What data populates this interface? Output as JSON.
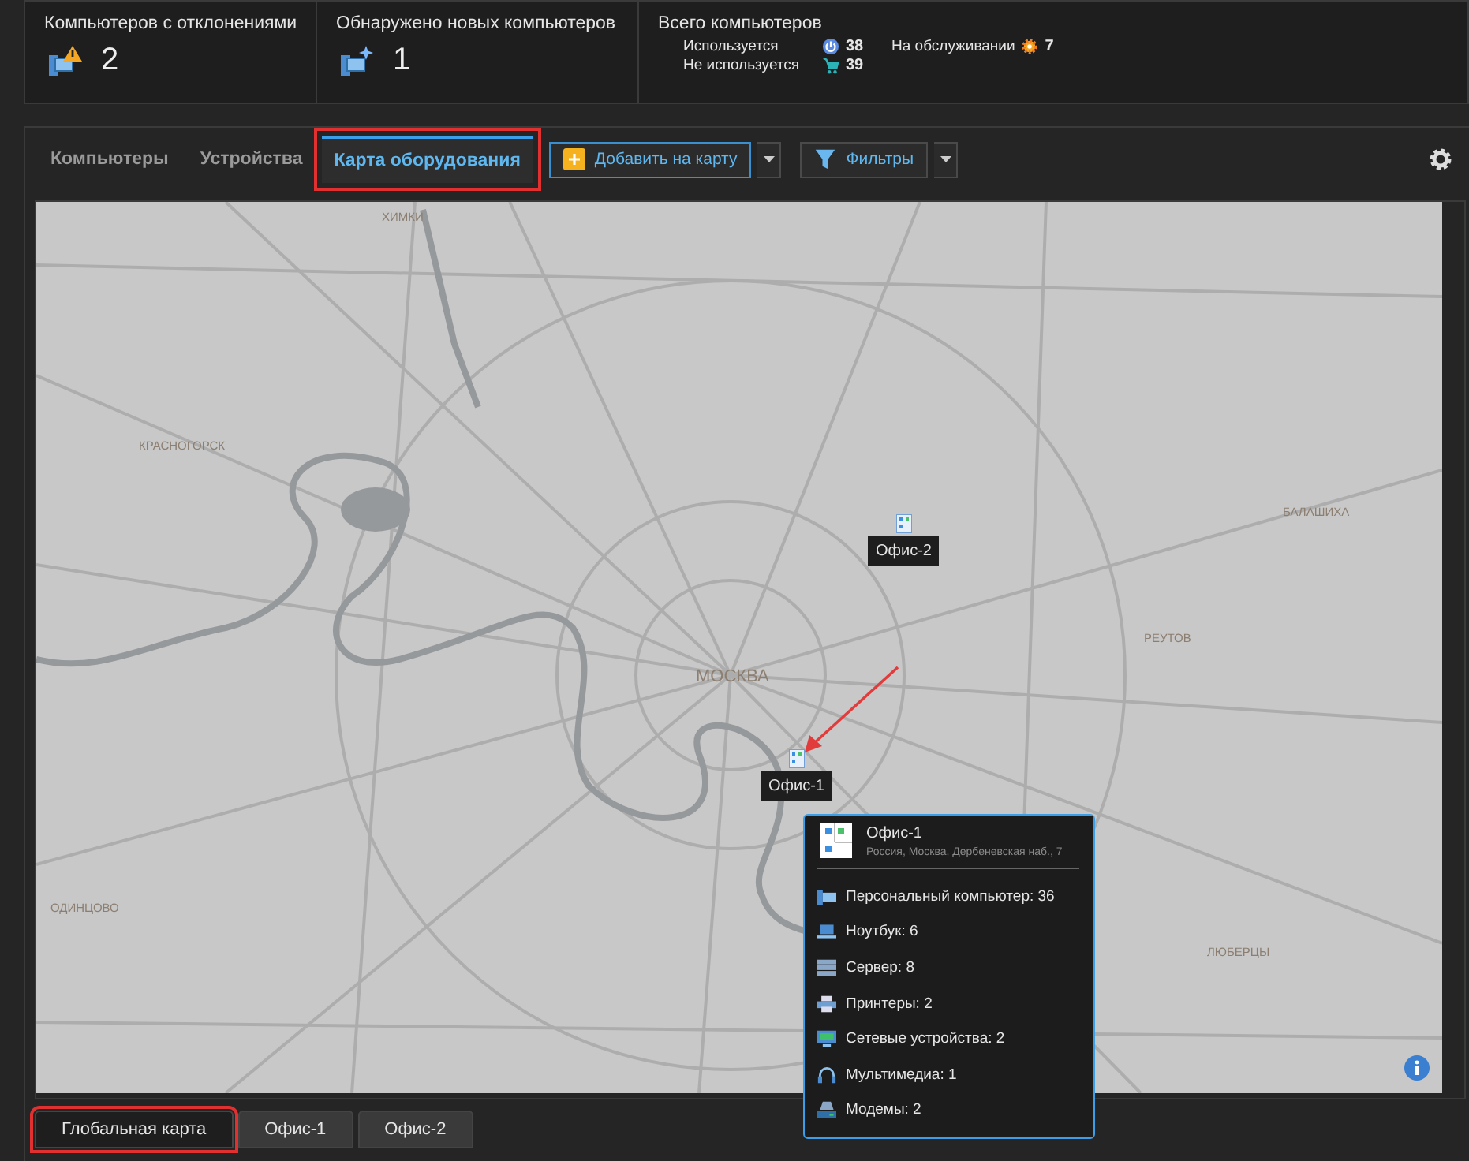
{
  "stats": [
    {
      "kind": "deviations",
      "label": "Компьютеров с отклонениями",
      "value": "2"
    },
    {
      "kind": "new",
      "label": "Обнаружено новых компьютеров",
      "value": "1"
    },
    {
      "kind": "total",
      "label": "Всего компьютеров",
      "items": [
        {
          "kind": "in-use",
          "label": "Используется",
          "value": "38"
        },
        {
          "kind": "not-used",
          "label": "Не используется",
          "value": "39"
        },
        {
          "kind": "maintenance",
          "label": "На обслуживании",
          "value": "7"
        }
      ]
    }
  ],
  "tabs": [
    {
      "label": "Компьютеры",
      "selected": false,
      "highlighted": false
    },
    {
      "label": "Устройства",
      "selected": false,
      "highlighted": false
    },
    {
      "label": "Карта оборудования",
      "selected": true,
      "highlighted": true
    }
  ],
  "toolbar": {
    "add_button": "Добавить на карту",
    "filter_button": "Фильтры"
  },
  "map": {
    "places": [
      "ХИМКИ",
      "КРАСНОГОРСК",
      "МОСКВА",
      "БАЛАШИХА",
      "РЕУТОВ",
      "ОДИНЦОВО",
      "ЛЮБЕРЦЫ"
    ],
    "markers": [
      {
        "label": "Офис-2"
      },
      {
        "label": "Офис-1"
      }
    ],
    "popup": {
      "title": "Офис-1",
      "address": "Россия, Москва, Дербеневская наб., 7",
      "items": [
        {
          "kind": "pc",
          "text": "Персональный компьютер: 36"
        },
        {
          "kind": "laptop",
          "text": "Ноутбук: 6"
        },
        {
          "kind": "server",
          "text": "Сервер: 8"
        },
        {
          "kind": "printer",
          "text": "Принтеры: 2"
        },
        {
          "kind": "network",
          "text": "Сетевые устройства: 2"
        },
        {
          "kind": "multimedia",
          "text": "Мультимедиа: 1"
        },
        {
          "kind": "modem",
          "text": "Модемы: 2"
        }
      ]
    }
  },
  "bottom_tabs": [
    {
      "label": "Глобальная карта",
      "selected": true,
      "highlighted": true
    },
    {
      "label": "Офис-1",
      "selected": false,
      "highlighted": false
    },
    {
      "label": "Офис-2",
      "selected": false,
      "highlighted": false
    }
  ]
}
